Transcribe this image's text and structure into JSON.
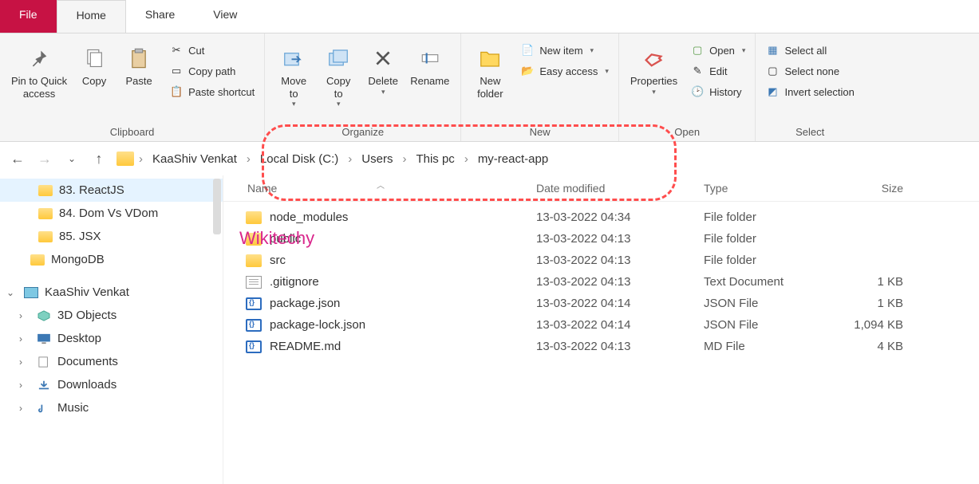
{
  "tabs": {
    "file": "File",
    "home": "Home",
    "share": "Share",
    "view": "View"
  },
  "ribbon": {
    "clipboard": {
      "label": "Clipboard",
      "pin": "Pin to Quick\naccess",
      "copy": "Copy",
      "paste": "Paste",
      "cut": "Cut",
      "copy_path": "Copy path",
      "paste_shortcut": "Paste shortcut"
    },
    "organize": {
      "label": "Organize",
      "move_to": "Move\nto",
      "copy_to": "Copy\nto",
      "delete": "Delete",
      "rename": "Rename"
    },
    "new": {
      "label": "New",
      "new_folder": "New\nfolder",
      "new_item": "New item",
      "easy_access": "Easy access"
    },
    "open": {
      "label": "Open",
      "properties": "Properties",
      "open": "Open",
      "edit": "Edit",
      "history": "History"
    },
    "select": {
      "label": "Select",
      "select_all": "Select all",
      "select_none": "Select none",
      "invert": "Invert selection"
    }
  },
  "breadcrumb": [
    "KaaShiv Venkat",
    "Local Disk (C:)",
    "Users",
    "This pc",
    "my-react-app"
  ],
  "sidebar": {
    "items": [
      {
        "label": "83. ReactJS",
        "kind": "folder",
        "selected": true,
        "indent": "deep2"
      },
      {
        "label": "84. Dom Vs VDom",
        "kind": "folder",
        "indent": "deep2"
      },
      {
        "label": "85. JSX",
        "kind": "folder",
        "indent": "deep2"
      },
      {
        "label": "MongoDB",
        "kind": "folder",
        "indent": "deeper"
      }
    ],
    "root": {
      "label": "KaaShiv Venkat",
      "expanded": true
    },
    "children": [
      {
        "label": "3D Objects",
        "icon": "cube"
      },
      {
        "label": "Desktop",
        "icon": "desktop"
      },
      {
        "label": "Documents",
        "icon": "doc"
      },
      {
        "label": "Downloads",
        "icon": "down"
      },
      {
        "label": "Music",
        "icon": "music"
      }
    ]
  },
  "columns": {
    "name": "Name",
    "date": "Date modified",
    "type": "Type",
    "size": "Size"
  },
  "files": [
    {
      "name": "node_modules",
      "date": "13-03-2022 04:34",
      "type": "File folder",
      "size": "",
      "icon": "folder"
    },
    {
      "name": "public",
      "date": "13-03-2022 04:13",
      "type": "File folder",
      "size": "",
      "icon": "folder"
    },
    {
      "name": "src",
      "date": "13-03-2022 04:13",
      "type": "File folder",
      "size": "",
      "icon": "folder"
    },
    {
      "name": ".gitignore",
      "date": "13-03-2022 04:13",
      "type": "Text Document",
      "size": "1 KB",
      "icon": "text"
    },
    {
      "name": "package.json",
      "date": "13-03-2022 04:14",
      "type": "JSON File",
      "size": "1 KB",
      "icon": "json"
    },
    {
      "name": "package-lock.json",
      "date": "13-03-2022 04:14",
      "type": "JSON File",
      "size": "1,094 KB",
      "icon": "json"
    },
    {
      "name": "README.md",
      "date": "13-03-2022 04:13",
      "type": "MD File",
      "size": "4 KB",
      "icon": "json"
    }
  ],
  "watermark": "Wikitechy"
}
